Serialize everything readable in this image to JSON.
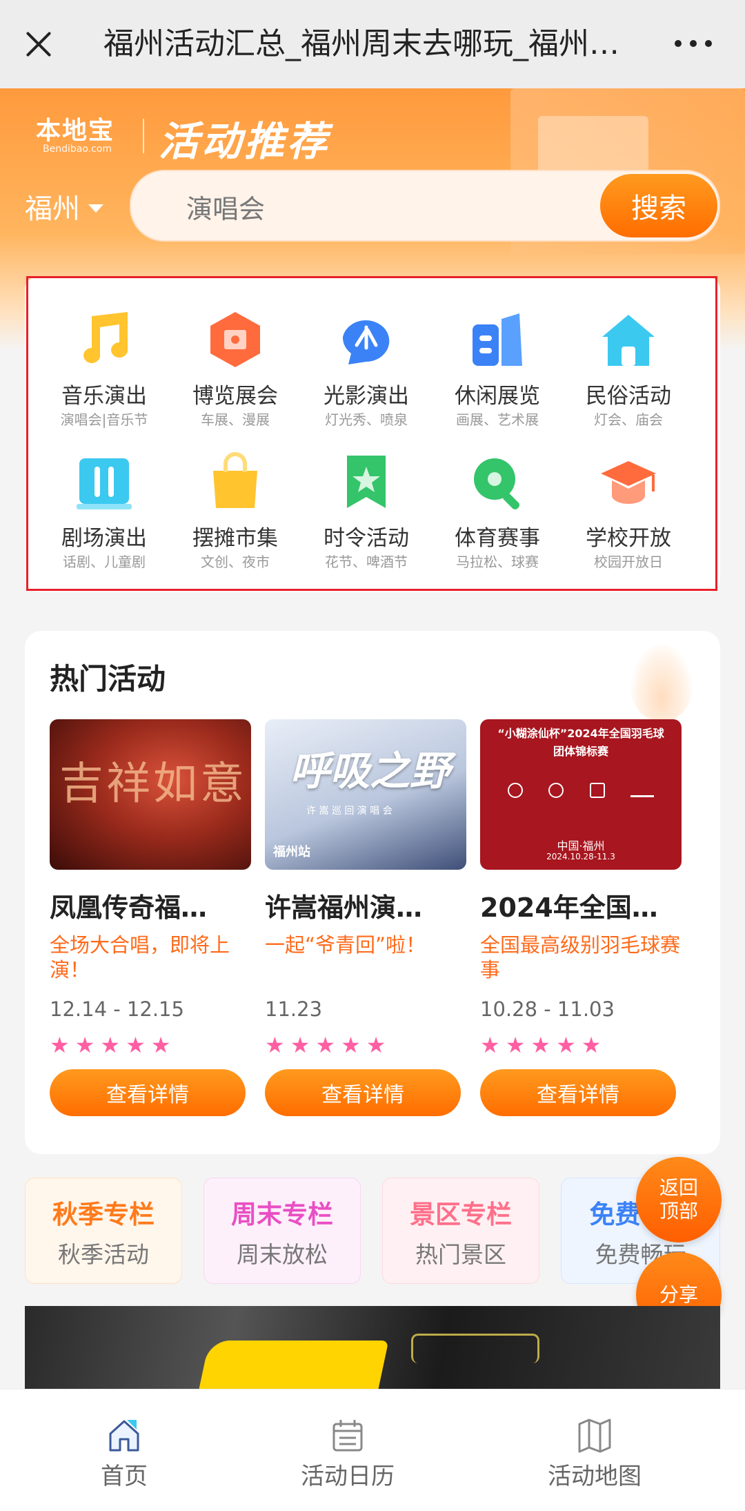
{
  "topbar": {
    "title": "福州活动汇总_福州周末去哪玩_福州…"
  },
  "header": {
    "logo_text": "本地宝",
    "logo_domain": "Bendibao.com",
    "title": "活动推荐",
    "city": "福州",
    "search_placeholder": "演唱会",
    "search_button": "搜索"
  },
  "categories": [
    {
      "name": "音乐演出",
      "sub": "演唱会|音乐节",
      "icon": "music-note-icon",
      "color": "#ffc42e"
    },
    {
      "name": "博览展会",
      "sub": "车展、漫展",
      "icon": "exhibition-icon",
      "color": "#ff6b3d"
    },
    {
      "name": "光影演出",
      "sub": "灯光秀、喷泉",
      "icon": "light-show-icon",
      "color": "#3b82f6"
    },
    {
      "name": "休闲展览",
      "sub": "画展、艺术展",
      "icon": "gallery-icon",
      "color": "#3b82f6"
    },
    {
      "name": "民俗活动",
      "sub": "灯会、庙会",
      "icon": "house-icon",
      "color": "#3bc9f0"
    },
    {
      "name": "剧场演出",
      "sub": "话剧、儿童剧",
      "icon": "theater-icon",
      "color": "#3bc9f0"
    },
    {
      "name": "摆摊市集",
      "sub": "文创、夜市",
      "icon": "shopping-bag-icon",
      "color": "#ffc42e"
    },
    {
      "name": "时令活动",
      "sub": "花节、啤酒节",
      "icon": "star-badge-icon",
      "color": "#34c46a"
    },
    {
      "name": "体育赛事",
      "sub": "马拉松、球赛",
      "icon": "ping-pong-icon",
      "color": "#34c46a"
    },
    {
      "name": "学校开放",
      "sub": "校园开放日",
      "icon": "graduation-cap-icon",
      "color": "#ff6b3d"
    }
  ],
  "hot": {
    "title": "热门活动",
    "events": [
      {
        "name": "凤凰传奇福…",
        "desc": "全场大合唱，即将上演！",
        "date": "12.14 - 12.15",
        "stars": "★★★★★",
        "button": "查看详情",
        "poster_text": "吉祥如意"
      },
      {
        "name": "许嵩福州演…",
        "desc": "一起“爷青回”啦！",
        "date": "11.23",
        "stars": "★★★★★",
        "button": "查看详情",
        "poster_text": "呼吸之野",
        "poster_sub": "许 嵩 巡 回 演 唱 会",
        "poster_city": "福州站"
      },
      {
        "name": "2024年全国…",
        "desc": "全国最高级别羽毛球赛事",
        "date": "10.28 - 11.03",
        "stars": "★★★★★",
        "button": "查看详情",
        "poster_text": "“小糊涂仙杯”2024年全国羽毛球团体锦标赛",
        "poster_city": "中国·福州",
        "poster_date": "2024.10.28-11.3"
      }
    ]
  },
  "columns": [
    {
      "title": "秋季专栏",
      "sub": "秋季活动",
      "color": "#ff7a1a",
      "bg": "#fff6ec"
    },
    {
      "title": "周末专栏",
      "sub": "周末放松",
      "color": "#e94fc4",
      "bg": "#fdf0fb"
    },
    {
      "title": "景区专栏",
      "sub": "热门景区",
      "color": "#ff6f8a",
      "bg": "#fff1f3"
    },
    {
      "title": "免费专栏",
      "sub": "免费畅玩",
      "color": "#3b82f6",
      "bg": "#eef5ff"
    }
  ],
  "fabs": {
    "top": "返回顶部",
    "share": "分享"
  },
  "bottom_nav": [
    {
      "label": "首页",
      "icon": "home-icon"
    },
    {
      "label": "活动日历",
      "icon": "calendar-icon"
    },
    {
      "label": "活动地图",
      "icon": "map-icon"
    }
  ]
}
